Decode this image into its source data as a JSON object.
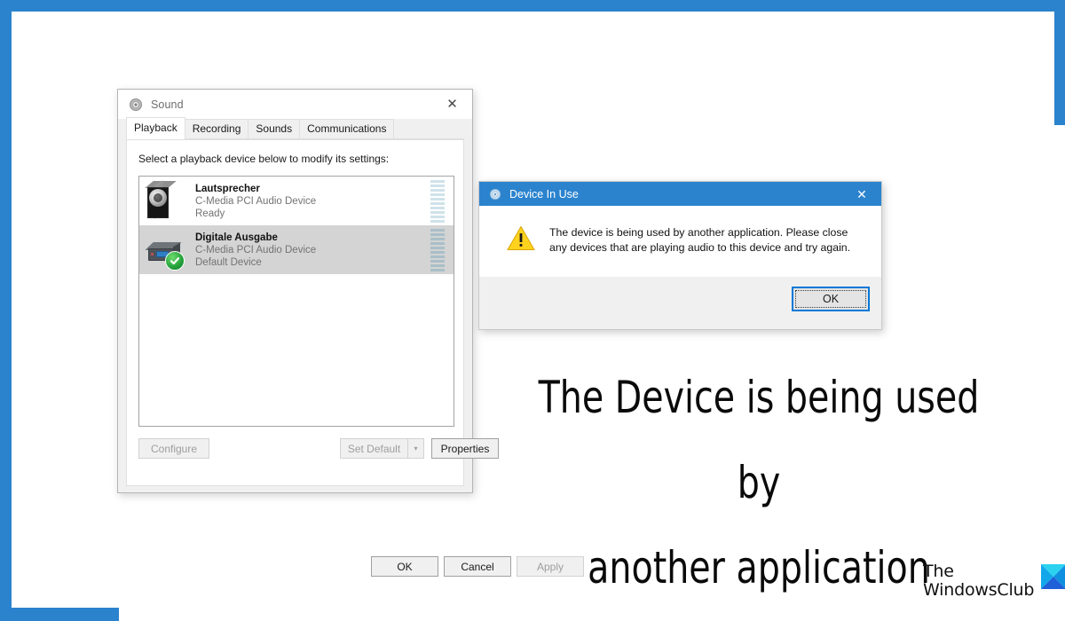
{
  "frame": {
    "accent_color": "#2b83ce"
  },
  "sound_dialog": {
    "title": "Sound",
    "title_icon": "speaker-icon",
    "close_label": "✕",
    "tabs": [
      {
        "label": "Playback",
        "active": true
      },
      {
        "label": "Recording",
        "active": false
      },
      {
        "label": "Sounds",
        "active": false
      },
      {
        "label": "Communications",
        "active": false
      }
    ],
    "prompt": "Select a playback device below to modify its settings:",
    "devices": [
      {
        "name": "Lautsprecher",
        "driver": "C-Media PCI Audio Device",
        "status": "Ready",
        "icon": "speaker-box-icon",
        "selected": false,
        "default": false,
        "meter_segments": 10
      },
      {
        "name": "Digitale Ausgabe",
        "driver": "C-Media PCI Audio Device",
        "status": "Default Device",
        "icon": "digital-output-icon",
        "selected": true,
        "default": true,
        "meter_segments": 10
      }
    ],
    "buttons": {
      "configure": {
        "label": "Configure",
        "accel": "C",
        "enabled": false
      },
      "set_default": {
        "label": "Set Default",
        "accel": "S",
        "enabled": false
      },
      "set_default_arrow": {
        "label": "▾",
        "enabled": false
      },
      "properties": {
        "label": "Properties",
        "accel": "P",
        "enabled": true
      },
      "ok": {
        "label": "OK",
        "enabled": true
      },
      "cancel": {
        "label": "Cancel",
        "enabled": true
      },
      "apply": {
        "label": "Apply",
        "enabled": false
      }
    }
  },
  "device_in_use_dialog": {
    "title": "Device In Use",
    "title_icon": "speaker-icon",
    "close_label": "✕",
    "titlebar_color": "#2b83ce",
    "warning_icon": "warning-triangle-icon",
    "message": "The device is being used by another application.  Please close any devices that are playing audio to this device and try again.",
    "ok_label": "OK",
    "ok_focused": true
  },
  "headline": {
    "line1": "The Device is being used by",
    "line2": "another application"
  },
  "watermark": {
    "line1": "The",
    "line2": "WindowsClub",
    "icon": "windowsclub-logo-icon",
    "icon_colors": {
      "top": "#2ad2f0",
      "left": "#12a7ea",
      "right": "#0f8fe0",
      "bottom": "#1f5fd8"
    }
  }
}
